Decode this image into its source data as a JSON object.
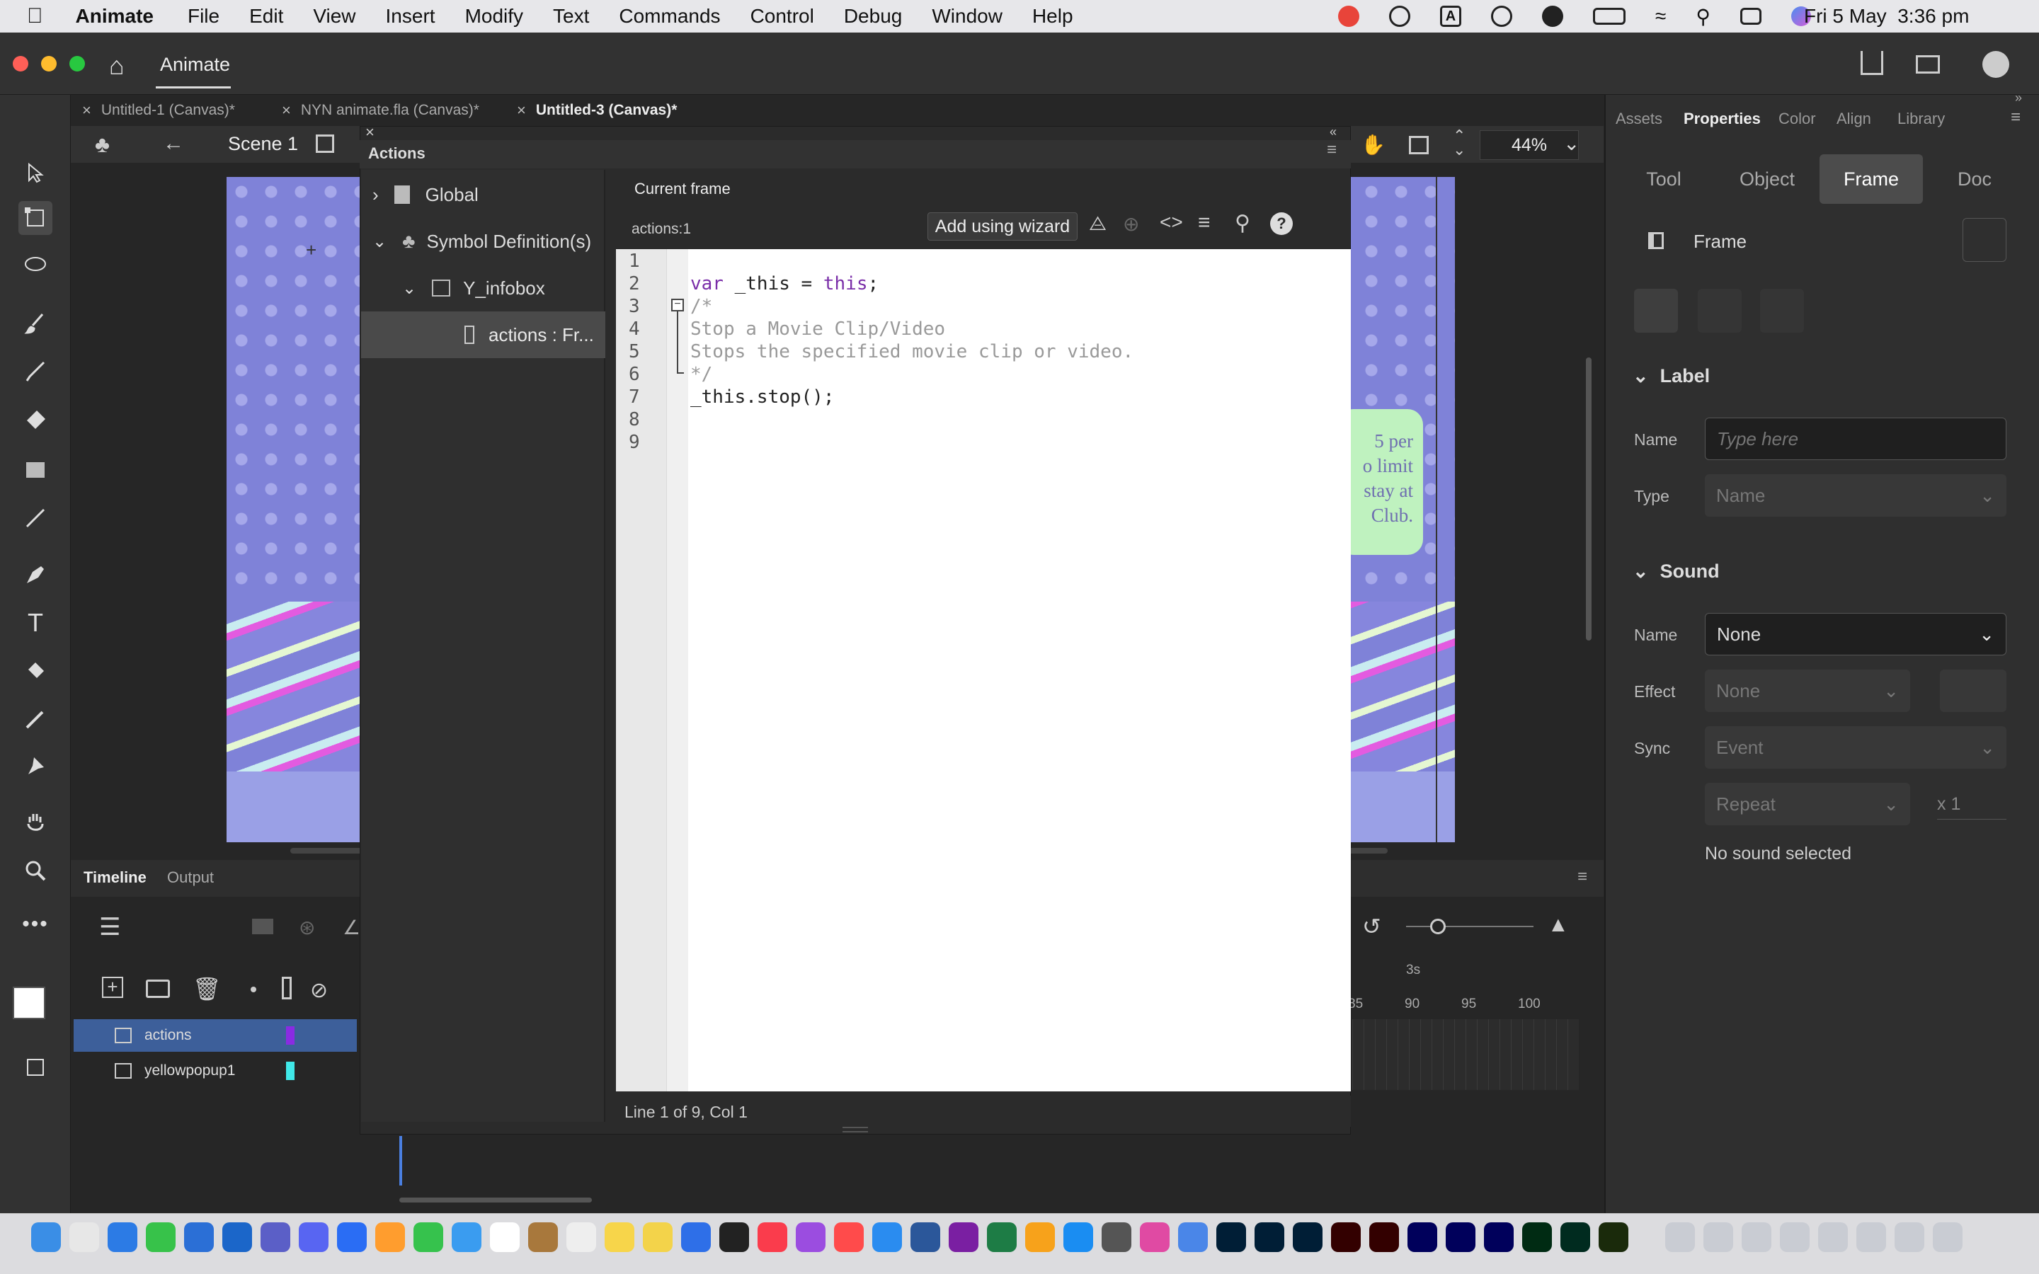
{
  "menubar": {
    "app": "Animate",
    "items": [
      "File",
      "Edit",
      "View",
      "Insert",
      "Modify",
      "Text",
      "Commands",
      "Control",
      "Debug",
      "Window",
      "Help"
    ],
    "clock": "Fri 5 May  3:36 pm"
  },
  "titlebar": {
    "title": "Animate"
  },
  "doc_tabs": [
    {
      "label": "Untitled-1 (Canvas)*"
    },
    {
      "label": "NYN animate.fla (Canvas)*"
    },
    {
      "label": "Untitled-3 (Canvas)*"
    }
  ],
  "scene": {
    "label": "Scene 1",
    "zoom": "44%"
  },
  "actions_panel": {
    "title": "Actions",
    "tree": [
      {
        "label": "Global"
      },
      {
        "label": "Symbol Definition(s)"
      },
      {
        "label": "Y_infobox"
      },
      {
        "label": "actions : Fr..."
      }
    ],
    "tab": "Current frame",
    "frame_label": "actions:1",
    "wizard_button": "Add using wizard",
    "line_numbers": [
      "1",
      "2",
      "3",
      "4",
      "5",
      "6",
      "7",
      "8",
      "9"
    ],
    "code": {
      "l2a": "var",
      "l2b": " _this = ",
      "l2c": "this",
      "l2d": ";",
      "l3": "/*",
      "l4": "Stop a Movie Clip/Video",
      "l5": "Stops the specified movie clip or video.",
      "l6": "*/",
      "l7": "_this.stop();"
    },
    "status": "Line 1 of 9, Col 1"
  },
  "stage_text": [
    "5 per",
    "o limit",
    "stay at",
    "Club."
  ],
  "timeline": {
    "tabs": [
      "Timeline",
      "Output"
    ],
    "layers": [
      {
        "name": "actions",
        "color": "#8a2be2"
      },
      {
        "name": "yellowpopup1",
        "color": "#40e8e8"
      }
    ],
    "ruler": {
      "seconds": "3s",
      "frames": [
        "85",
        "90",
        "95",
        "100"
      ]
    }
  },
  "right_panel": {
    "tabs": [
      "Assets",
      "Properties",
      "Color",
      "Align",
      "Library"
    ],
    "segments": [
      "Tool",
      "Object",
      "Frame",
      "Doc"
    ],
    "header": "Frame",
    "label_section": {
      "title": "Label",
      "name_label": "Name",
      "name_placeholder": "Type here",
      "type_label": "Type",
      "type_value": "Name"
    },
    "sound_section": {
      "title": "Sound",
      "name_label": "Name",
      "name_value": "None",
      "effect_label": "Effect",
      "effect_value": "None",
      "sync_label": "Sync",
      "sync_value": "Event",
      "repeat_value": "Repeat",
      "repeat_count": "x 1",
      "note": "No sound selected"
    }
  }
}
